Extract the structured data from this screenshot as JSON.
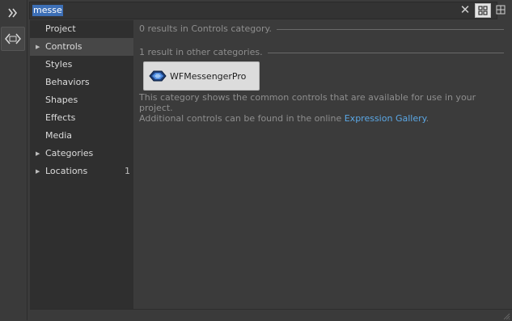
{
  "search": {
    "query": "messe",
    "clear_icon": "✕"
  },
  "toolbar": {
    "expand_icon": "double-chevron-right-icon",
    "assets_icon": "assets-icon",
    "grid_view_icon": "grid-view-icon",
    "list_view_icon": "list-view-icon"
  },
  "sidebar": {
    "items": [
      {
        "label": "Project",
        "arrow": "",
        "count": ""
      },
      {
        "label": "Controls",
        "arrow": "▶",
        "count": "",
        "selected": true
      },
      {
        "label": "Styles",
        "arrow": "",
        "count": ""
      },
      {
        "label": "Behaviors",
        "arrow": "",
        "count": ""
      },
      {
        "label": "Shapes",
        "arrow": "",
        "count": ""
      },
      {
        "label": "Effects",
        "arrow": "",
        "count": ""
      },
      {
        "label": "Media",
        "arrow": "",
        "count": ""
      },
      {
        "label": "Categories",
        "arrow": "▶",
        "count": ""
      },
      {
        "label": "Locations",
        "arrow": "▶",
        "count": "1"
      }
    ]
  },
  "main": {
    "category_results": "0 results in Controls category.",
    "other_results": "1 result in other categories.",
    "result_item": {
      "label": "WFMessengerPro",
      "icon": "control-icon"
    },
    "description_line1": "This category shows the common controls that are available for use in your project.",
    "description_line2_prefix": "Additional controls can be found in the online ",
    "gallery_link": "Expression Gallery",
    "description_line2_suffix": "."
  },
  "colors": {
    "background": "#3b3b3b",
    "sidebar": "#2f2f2f",
    "selection": "#474747",
    "search_highlight": "#3d6fb6",
    "link": "#5ba8e6"
  }
}
